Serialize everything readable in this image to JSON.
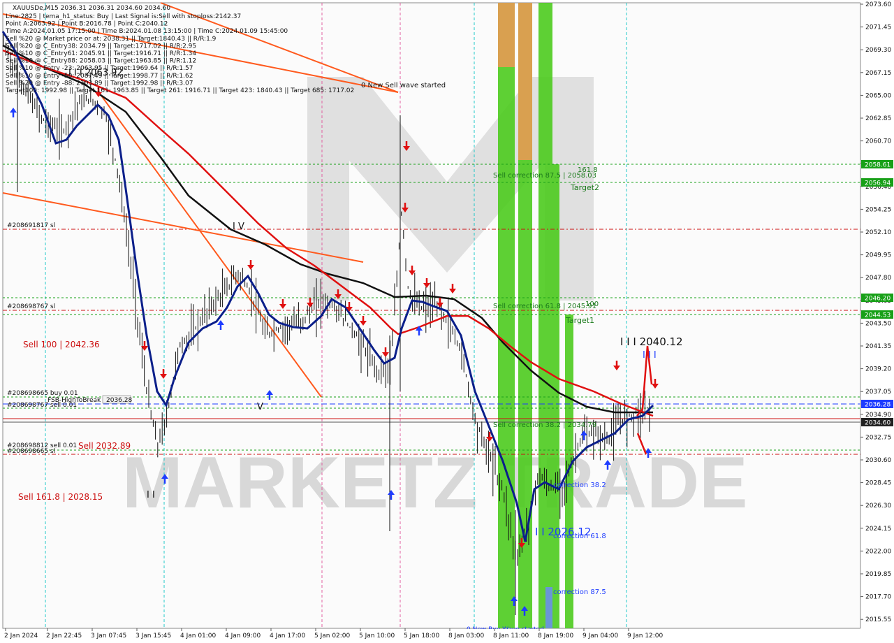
{
  "header": {
    "symbol_line": "XAUUSDe,M15  2036.31 2036.31 2034.60 2034.60",
    "info_lines": [
      "Line:2825 | tema_h1_status: Buy | Last Signal is:Sell with stoploss:2142.37",
      "Point A:2063.92 | Point B:2016.78 | Point C:2040.12",
      "Time A:2024.01.05 17:15:00 | Time B:2024.01.08 13:15:00 | Time C:2024.01.09 15:45:00",
      "Sell %20 @ Market price or at: 2038.31 || Target:1840.43 || R/R:1.9",
      "Sell %20 @ C_Entry38: 2034.79 || Target:1717.02 || R/R:2.95",
      "Sell %10 @ C_Entry61: 2045.91 || Target:1916.71 || R/R:1.34",
      "Sell %10 @ C_Entry88: 2058.03 || Target:1963.85 || R/R:1.12",
      "Sell %10 @ Entry -23: 2063.95 || Target:1969.64 || R/R:1.57",
      "Sell %10 @ Entry -50: 2087.49 || Target:1998.77 || R/R:1.62",
      "Sell %20 @ Entry -88: 2103.89 || Target:1992.98 || R/R:3.07",
      "Target100: 1992.98 || Target 161: 1963.85 || Target 261: 1916.71 || Target 423: 1840.43 || Target 685: 1717.02"
    ]
  },
  "y_axis": {
    "labels": [
      "2073.60",
      "2071.45",
      "2069.30",
      "2067.15",
      "2065.00",
      "2062.85",
      "2060.70",
      "2058.55",
      "2056.40",
      "2054.25",
      "2052.10",
      "2049.95",
      "2047.80",
      "2045.65",
      "2043.50",
      "2041.35",
      "2039.20",
      "2037.05",
      "2034.90",
      "2032.75",
      "2030.60",
      "2028.45",
      "2026.30",
      "2024.15",
      "2022.00",
      "2019.85",
      "2017.70",
      "2015.55"
    ],
    "badges": [
      {
        "text": "2058.61",
        "color": "#18a018"
      },
      {
        "text": "2056.94",
        "color": "#18a018"
      },
      {
        "text": "2046.20",
        "color": "#18a018"
      },
      {
        "text": "2044.53",
        "color": "#18a018"
      },
      {
        "text": "2036.28",
        "color": "#1e3cff"
      },
      {
        "text": "2034.60",
        "color": "#222222"
      }
    ]
  },
  "x_axis": {
    "labels": [
      "2 Jan 2024",
      "2 Jan 22:45",
      "3 Jan 07:45",
      "3 Jan 15:45",
      "4 Jan 01:00",
      "4 Jan 09:00",
      "4 Jan 17:00",
      "5 Jan 02:00",
      "5 Jan 10:00",
      "5 Jan 18:00",
      "8 Jan 03:00",
      "8 Jan 11:00",
      "8 Jan 19:00",
      "9 Jan 04:00",
      "9 Jan 12:00"
    ]
  },
  "annotations": {
    "new_sell_wave": "0 New Sell wave started",
    "new_buy_wave": "0 New Buy Wave started",
    "sell_corr_875": "Sell correction 87.5 | 2058.03",
    "sell_corr_618": "Sell correction 61.8 | 2045.91",
    "sell_corr_382": "Sell correction 38.2 | 2034.79",
    "target_1618": "161.8",
    "target2": "Target2",
    "target_100": "100",
    "target1": "Target1",
    "wave_c_label": "I I I 2040.12",
    "wave_iii_label": "I I I",
    "wave_iv_label": "I V",
    "wave_v_label": "V",
    "wave_ii_label": "I I",
    "top_left_label": "I I I 2063.92",
    "wave_b_label": "I I 2026.12",
    "corr_382": "correction 38.2",
    "corr_618": "correction 61.8",
    "corr_875": "correction 87.5",
    "sl_1": "#208691817 sl",
    "sl_2": "#208698767 sl",
    "sl_3": "#208698665 buy 0.01",
    "sl_4": "#208698767 sell 0.01",
    "sl_5": "#208698812 sell 0.01",
    "sl_6": "#208698665 sl",
    "fsb_label": "FSB-HighToBreak",
    "fsb_value": "2036.28",
    "sell_100": "Sell 100 | 2042.36",
    "sell_1618": "Sell 161.8 | 2028.15",
    "sell_2032": "Sell 2032.89",
    "watermark": "MARKETZ TRADE"
  },
  "colors": {
    "tema_blue": "#0b1f8a",
    "ma_black": "#111111",
    "ma_red": "#e01010",
    "trend_orange": "#ff5a1e",
    "green_zone": "#4ccb1e",
    "orange_zone": "#d9a050",
    "blue_zone": "#6a96d6"
  }
}
